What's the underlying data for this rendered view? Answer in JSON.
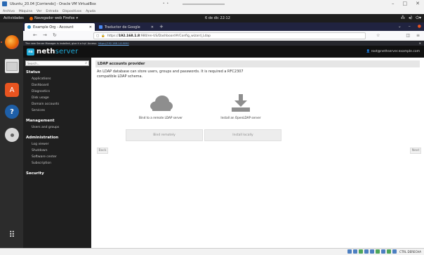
{
  "vbox": {
    "title": "Ubuntu_20.04 [Corriendo] - Oracle VM VirtualBox",
    "menu": [
      "Archivo",
      "Máquina",
      "Ver",
      "Entrada",
      "Dispositivos",
      "Ayuda"
    ],
    "win_buttons": {
      "minimize": "–",
      "maximize": "□",
      "close": "✕"
    },
    "host_key": "CTRL DERECHA"
  },
  "ubuntu_bar": {
    "activities": "Actividades",
    "app_menu": "Navegador web Firefox",
    "clock": "6 de dic 22:12"
  },
  "firefox": {
    "tabs": [
      {
        "label": "Example Org - Account",
        "active": true
      },
      {
        "label": "Traductor de Google",
        "active": false
      }
    ],
    "url_prefix": "https://",
    "url_host": "192.168.1.8",
    "url_path": ":980/en-US/Dashboard#/Config_wizard_Ldap",
    "notification": "The new Server Manager is installed, give it a try! Access:",
    "notification_link": "https://192.168.1.8:9090"
  },
  "neth": {
    "logo_badge": "ns",
    "logo_word_1": "neth",
    "logo_word_2": "server",
    "user": "root@nethserver.example.com"
  },
  "sidebar": {
    "search_placeholder": "Search...",
    "sections": [
      {
        "heading": "Status",
        "items": [
          "Applications",
          "Dashboard",
          "Diagnostics",
          "Disk usage",
          "Domain accounts",
          "Services"
        ]
      },
      {
        "heading": "Management",
        "items": [
          "Users and groups"
        ]
      },
      {
        "heading": "Administration",
        "items": [
          "Log viewer",
          "Shutdown",
          "Software center",
          "Subscription"
        ]
      },
      {
        "heading": "Security",
        "items": []
      }
    ]
  },
  "main": {
    "title": "LDAP accounts provider",
    "description": "An LDAP database can store users, groups and passwords. It is required a RFC2307 compatible LDAP schema.",
    "remote_label": "Bind to a remote LDAP server",
    "local_label": "Install an OpenLDAP server",
    "remote_button": "Bind remotely",
    "local_button": "Install locally",
    "back": "Back",
    "next": "Next"
  }
}
